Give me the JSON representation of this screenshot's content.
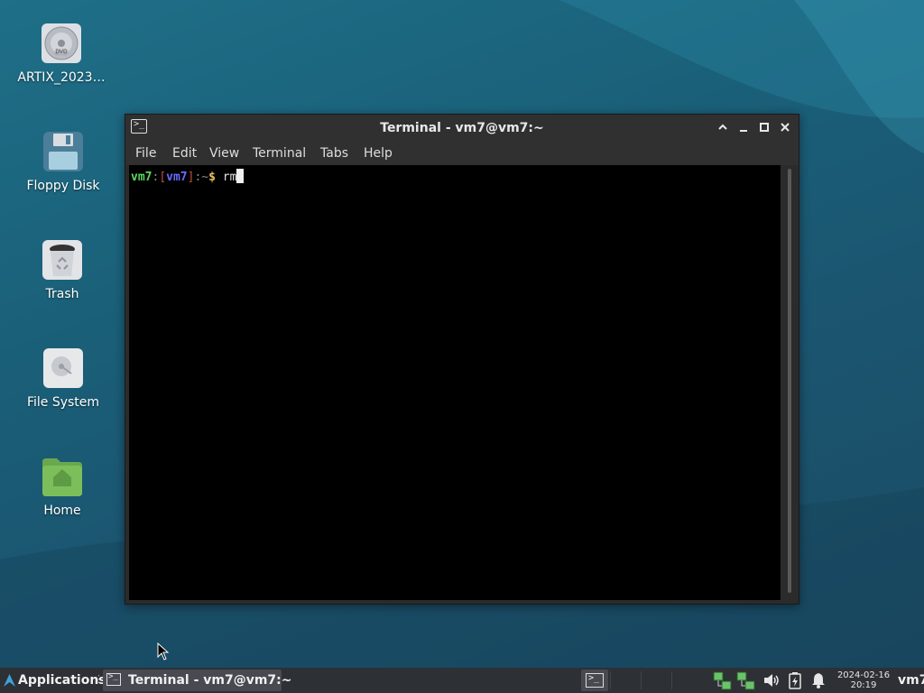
{
  "desktop": {
    "icons": [
      {
        "label": "ARTIX_2023…",
        "icon": "optical-disc-icon"
      },
      {
        "label": "Floppy Disk",
        "icon": "floppy-disk-icon"
      },
      {
        "label": "Trash",
        "icon": "trash-icon"
      },
      {
        "label": "File System",
        "icon": "hard-drive-icon"
      },
      {
        "label": "Home",
        "icon": "home-folder-icon"
      }
    ]
  },
  "window": {
    "title": "Terminal - vm7@vm7:~",
    "controls": {
      "shade": "⌃",
      "minimize": "–",
      "maximize": "◻",
      "close": "✕"
    },
    "menu": [
      "File",
      "Edit",
      "View",
      "Terminal",
      "Tabs",
      "Help"
    ]
  },
  "terminal": {
    "prompt_user": "vm7",
    "prompt_sep1": ":",
    "prompt_lbracket": "[",
    "prompt_host": "vm7",
    "prompt_rbracket": "]",
    "prompt_sep2": ":",
    "prompt_path": "~",
    "prompt_symbol": "$",
    "command": "rm"
  },
  "taskbar": {
    "applications_label": "Applications",
    "task_label": "Terminal - vm7@vm7:~",
    "clock_date": "2024-02-16",
    "clock_time": "20:19",
    "user": "vm7",
    "tray_icons": [
      "network-icon",
      "network-icon",
      "volume-icon",
      "battery-icon",
      "notification-bell-icon"
    ]
  },
  "colors": {
    "prompt_user": "#5fd75f",
    "prompt_host": "#6b6bff",
    "prompt_bracket": "#c44a4a",
    "prompt_symbol": "#e5c15c"
  }
}
